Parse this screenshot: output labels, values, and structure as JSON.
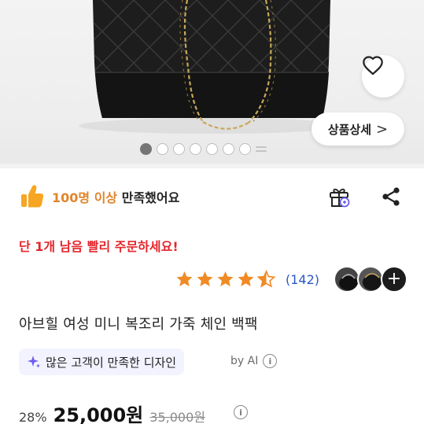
{
  "product_image": {
    "dots_total": 8,
    "active_index": 0,
    "detail_button_label": "상품상세",
    "detail_button_arrow": ">"
  },
  "icons": {
    "wish": "heart-icon",
    "gift": "gift-icon",
    "share": "share-icon",
    "thumb": "thumbs-up-icon",
    "sparkle": "sparkle-icon",
    "info": "info-icon"
  },
  "satisfaction": {
    "highlight": "100명 이상",
    "rest": "만족했어요"
  },
  "stock_warning": "단 1개 남음 빨리 주문하세요!",
  "rating": {
    "value": 4.5,
    "max": 5,
    "review_count": "(142)"
  },
  "reviewer_more": "+",
  "title": "아브힐 여성 미니 복조리 가죽 체인 백팩",
  "ai_summary": {
    "text": "많은 고객이 만족한 디자인",
    "by": "by AI",
    "info_glyph": "i"
  },
  "price": {
    "discount": "28%",
    "sale": "25,000원",
    "original": "35,000원",
    "info_glyph": "i"
  },
  "colors": {
    "accent_orange": "#e0852b",
    "warning_red": "#e4262c",
    "link_blue": "#2c57c7",
    "star": "#f08a24",
    "ai_purple": "#6a5cf0"
  }
}
